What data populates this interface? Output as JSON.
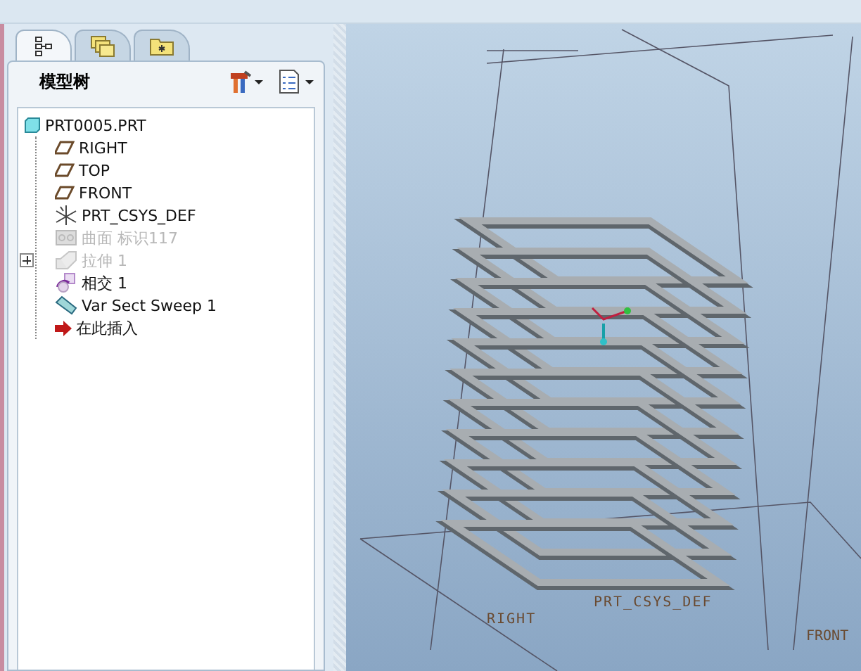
{
  "navigator": {
    "tabs": [
      {
        "kind": "tree",
        "selected": true
      },
      {
        "kind": "layers",
        "selected": false
      },
      {
        "kind": "favorites",
        "selected": false
      }
    ],
    "title": "模型树",
    "tree": {
      "label": "PRT0005.PRT",
      "kind": "part",
      "children": [
        {
          "label": "RIGHT",
          "kind": "plane",
          "disabled": false,
          "expandable": false
        },
        {
          "label": "TOP",
          "kind": "plane",
          "disabled": false,
          "expandable": false
        },
        {
          "label": "FRONT",
          "kind": "plane",
          "disabled": false,
          "expandable": false
        },
        {
          "label": "PRT_CSYS_DEF",
          "kind": "csys",
          "disabled": false,
          "expandable": false
        },
        {
          "label": "曲面 标识117",
          "kind": "surface",
          "disabled": true,
          "expandable": false
        },
        {
          "label": "拉伸 1",
          "kind": "extrude",
          "disabled": true,
          "expandable": true
        },
        {
          "label": "相交 1",
          "kind": "intersect",
          "disabled": false,
          "expandable": false
        },
        {
          "label": "Var Sect Sweep 1",
          "kind": "sweep",
          "disabled": false,
          "expandable": false
        },
        {
          "label": "在此插入",
          "kind": "insert",
          "disabled": false,
          "expandable": false
        }
      ]
    }
  },
  "viewport": {
    "labels": [
      {
        "kind": "csys",
        "text": "PRT_CSYS_DEF"
      },
      {
        "kind": "right",
        "text": "RIGHT"
      },
      {
        "kind": "front",
        "text": "FRONT"
      }
    ]
  }
}
